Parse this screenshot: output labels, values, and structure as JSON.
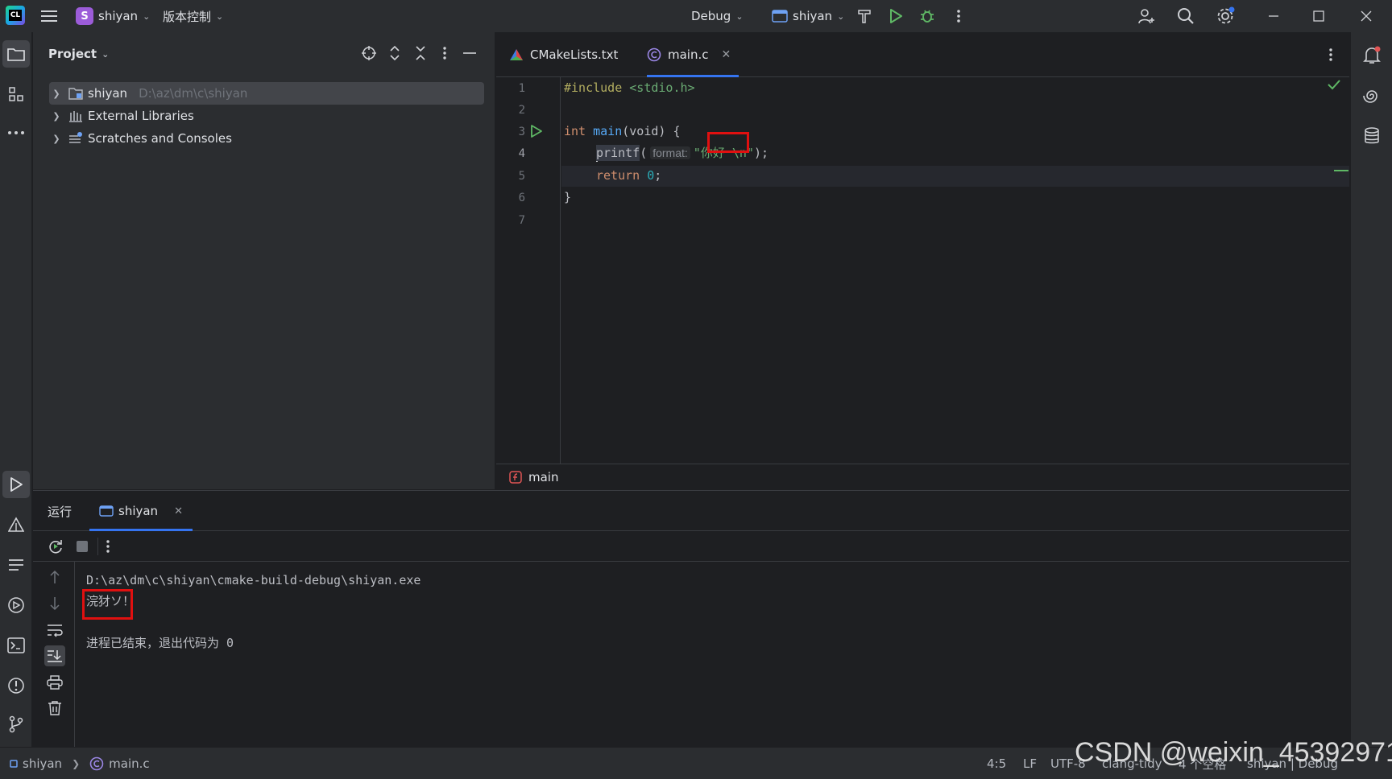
{
  "titlebar": {
    "project_badge": "S",
    "project_name": "shiyan",
    "vcs_label": "版本控制",
    "config_label": "Debug",
    "run_target": "shiyan"
  },
  "project_panel": {
    "title": "Project",
    "tree": [
      {
        "label": "shiyan",
        "path": "D:\\az\\dm\\c\\shiyan"
      },
      {
        "label": "External Libraries",
        "path": ""
      },
      {
        "label": "Scratches and Consoles",
        "path": ""
      }
    ]
  },
  "editor": {
    "tabs": [
      {
        "label": "CMakeLists.txt",
        "icon": "cmake-icon"
      },
      {
        "label": "main.c",
        "icon": "c-file-icon"
      }
    ],
    "line_numbers": [
      "1",
      "2",
      "3",
      "4",
      "5",
      "6",
      "7"
    ],
    "code": {
      "line1_directive": "#include",
      "line1_header": "<stdio.h>",
      "line3_type": "int",
      "line3_name": "main",
      "line3_rest": "(void) {",
      "line4_fn": "printf",
      "line4_open": "(",
      "line4_hint": "format:",
      "line4_str_open": "\"你好",
      "line4_str_close": "\\n\"",
      "line4_close": ");",
      "line5_kw": "return",
      "line5_num": "0",
      "line5_semi": ";",
      "line6": "}"
    },
    "breadcrumb": "main"
  },
  "run_panel": {
    "title": "运行",
    "tab": "shiyan",
    "console": [
      "D:\\az\\dm\\c\\shiyan\\cmake-build-debug\\shiyan.exe",
      "浣犲ソ！",
      "",
      "进程已结束，退出代码为 0"
    ]
  },
  "statusbar": {
    "project": "shiyan",
    "file": "main.c",
    "position": "4:5",
    "line_sep": "LF",
    "encoding": "UTF-8",
    "inspector": "clang-tidy",
    "indent": "4 个空格",
    "context": "shiyan | Debug"
  },
  "watermark": "CSDN @weixin_45392971"
}
